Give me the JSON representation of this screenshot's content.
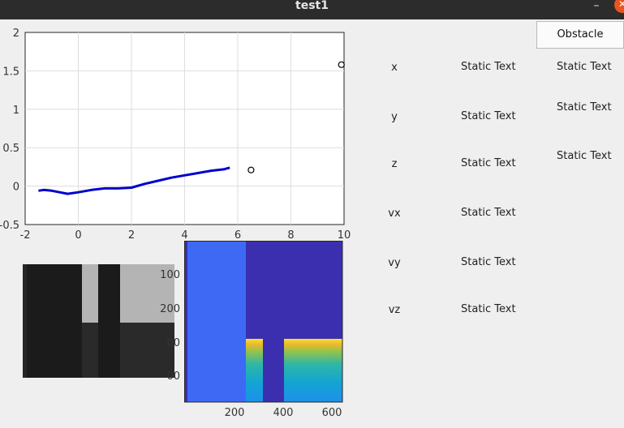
{
  "window": {
    "title": "test1",
    "minimize_glyph": "–",
    "close_glyph": "✕"
  },
  "chart_data": [
    {
      "type": "line",
      "xlim": [
        -2,
        10
      ],
      "ylim": [
        -0.5,
        2
      ],
      "xticks": [
        "-2",
        "0",
        "2",
        "4",
        "6",
        "8",
        "10"
      ],
      "yticks": [
        "2",
        "1.5",
        "1",
        "0.5",
        "0",
        "-0.5"
      ],
      "grid": true,
      "series": [
        {
          "color": "#0000cc",
          "x": [
            -1.5,
            -1.3,
            -1.0,
            -0.7,
            -0.4,
            0.0,
            0.5,
            1.0,
            1.5,
            2.0,
            2.5,
            3.0,
            3.5,
            4.0,
            4.5,
            5.0,
            5.5,
            5.7
          ],
          "y": [
            -0.06,
            -0.05,
            -0.06,
            -0.08,
            -0.1,
            -0.08,
            -0.05,
            -0.03,
            -0.03,
            -0.02,
            0.03,
            0.07,
            0.11,
            0.14,
            0.17,
            0.2,
            0.22,
            0.24
          ]
        }
      ],
      "markers": [
        {
          "x": 6.5,
          "y": 0.21,
          "shape": "circle"
        },
        {
          "x": 9.9,
          "y": 1.58,
          "shape": "circle"
        }
      ]
    },
    {
      "type": "heatmap",
      "xticks": [
        "200",
        "400",
        "600"
      ],
      "yticks": [
        "100",
        "200",
        "00",
        "00"
      ],
      "colormap": "parula"
    }
  ],
  "camera_image": {
    "description_none": ""
  },
  "controls": {
    "obstacle_button": "Obstacle",
    "rows": [
      {
        "label": "x",
        "value1": "Static Text",
        "value2": "Static Text"
      },
      {
        "label": "y",
        "value1": "Static Text",
        "value2": "Static Text"
      },
      {
        "label": "z",
        "value1": "Static Text",
        "value2": "Static Text"
      },
      {
        "label": "vx",
        "value1": "Static Text"
      },
      {
        "label": "vy",
        "value1": "Static Text"
      },
      {
        "label": "vz",
        "value1": "Static Text"
      }
    ]
  }
}
